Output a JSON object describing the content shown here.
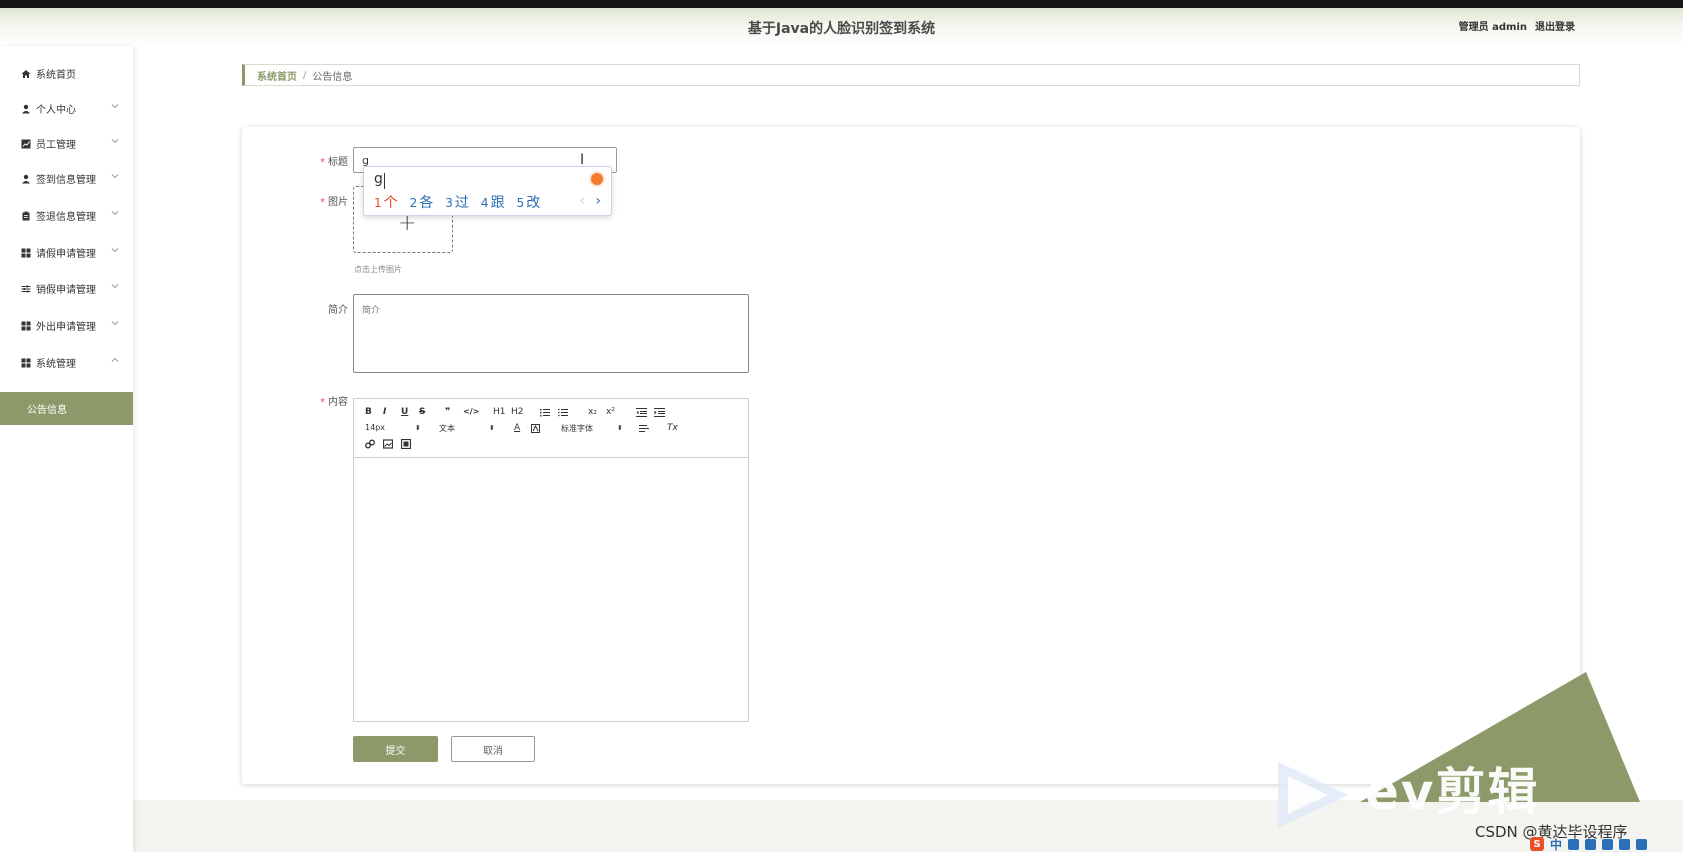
{
  "header": {
    "title": "基于Java的人脸识别签到系统",
    "user_label": "管理员 admin",
    "logout_label": "退出登录"
  },
  "sidebar": {
    "items": [
      {
        "label": "系统首页",
        "icon": "home-icon"
      },
      {
        "label": "个人中心",
        "icon": "person-icon"
      },
      {
        "label": "员工管理",
        "icon": "chart-icon"
      },
      {
        "label": "签到信息管理",
        "icon": "person-icon"
      },
      {
        "label": "签退信息管理",
        "icon": "clipboard-icon"
      },
      {
        "label": "请假申请管理",
        "icon": "grid-icon"
      },
      {
        "label": "销假申请管理",
        "icon": "sliders-icon"
      },
      {
        "label": "外出申请管理",
        "icon": "grid-icon"
      },
      {
        "label": "系统管理",
        "icon": "grid-icon"
      }
    ],
    "active_sub": "公告信息"
  },
  "breadcrumb": {
    "home": "系统首页",
    "separator": "/",
    "current": "公告信息"
  },
  "form": {
    "title_label": "标题",
    "title_value": "g",
    "image_label": "图片",
    "upload_tip": "点击上传图片",
    "intro_label": "简介",
    "intro_placeholder": "简介",
    "content_label": "内容",
    "submit_label": "提交",
    "cancel_label": "取消"
  },
  "ime": {
    "pinyin": "g",
    "candidates": [
      {
        "num": "1",
        "text": "个"
      },
      {
        "num": "2",
        "text": "各"
      },
      {
        "num": "3",
        "text": "过"
      },
      {
        "num": "4",
        "text": "跟"
      },
      {
        "num": "5",
        "text": "改"
      }
    ],
    "prev": "‹",
    "next": "›"
  },
  "editor": {
    "font_size": "14px",
    "text_style": "文本",
    "font_family": "标准字体",
    "h1": "H1",
    "h2": "H2",
    "bold": "B",
    "italic": "I",
    "underline": "U",
    "strike": "S",
    "quote": "❞",
    "code": "</>",
    "sub": "x₂",
    "sup": "x²",
    "color": "A",
    "clear": "Tx"
  },
  "watermark": {
    "brand": "ev剪辑",
    "csdn": "CSDN @黄达毕设程序"
  },
  "ime_bar": {
    "lang": "中"
  },
  "colors": {
    "accent": "#8c9a6a",
    "required": "#e25050"
  }
}
